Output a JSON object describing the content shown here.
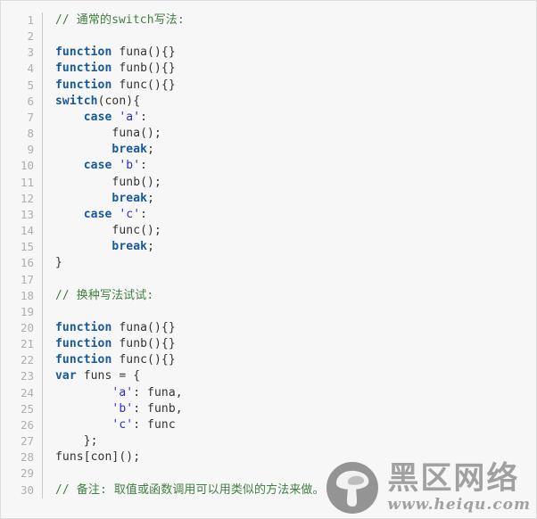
{
  "editor": {
    "title": "javascript-switch-alternative-snippet",
    "language": "javascript",
    "first_line_number": 1,
    "total_lines": 30,
    "colors": {
      "background": "#f7f7f7",
      "border": "#dcdcdc",
      "gutter_text": "#aeaeae",
      "gutter_divider": "#c9c9c9",
      "plain_text": "#333333",
      "keyword": "#15599b",
      "string": "#2b2bc8",
      "comment": "#3f7f3f"
    },
    "lines": [
      {
        "number": "1",
        "tokens": [
          {
            "t": "// 通常的switch写法:",
            "c": "comment"
          }
        ]
      },
      {
        "number": "2",
        "tokens": []
      },
      {
        "number": "3",
        "tokens": [
          {
            "t": "function",
            "c": "kw"
          },
          {
            "t": " funa(){}",
            "c": "plain"
          }
        ]
      },
      {
        "number": "4",
        "tokens": [
          {
            "t": "function",
            "c": "kw"
          },
          {
            "t": " funb(){}",
            "c": "plain"
          }
        ]
      },
      {
        "number": "5",
        "tokens": [
          {
            "t": "function",
            "c": "kw"
          },
          {
            "t": " func(){}",
            "c": "plain"
          }
        ]
      },
      {
        "number": "6",
        "tokens": [
          {
            "t": "switch",
            "c": "kw"
          },
          {
            "t": "(con){",
            "c": "plain"
          }
        ]
      },
      {
        "number": "7",
        "tokens": [
          {
            "t": "    ",
            "c": "plain"
          },
          {
            "t": "case",
            "c": "kw"
          },
          {
            "t": " ",
            "c": "plain"
          },
          {
            "t": "'a'",
            "c": "str"
          },
          {
            "t": ":",
            "c": "plain"
          }
        ]
      },
      {
        "number": "8",
        "tokens": [
          {
            "t": "        funa();",
            "c": "plain"
          }
        ]
      },
      {
        "number": "9",
        "tokens": [
          {
            "t": "        ",
            "c": "plain"
          },
          {
            "t": "break",
            "c": "kw"
          },
          {
            "t": ";",
            "c": "plain"
          }
        ]
      },
      {
        "number": "10",
        "tokens": [
          {
            "t": "    ",
            "c": "plain"
          },
          {
            "t": "case",
            "c": "kw"
          },
          {
            "t": " ",
            "c": "plain"
          },
          {
            "t": "'b'",
            "c": "str"
          },
          {
            "t": ":",
            "c": "plain"
          }
        ]
      },
      {
        "number": "11",
        "tokens": [
          {
            "t": "        funb();",
            "c": "plain"
          }
        ]
      },
      {
        "number": "12",
        "tokens": [
          {
            "t": "        ",
            "c": "plain"
          },
          {
            "t": "break",
            "c": "kw"
          },
          {
            "t": ";",
            "c": "plain"
          }
        ]
      },
      {
        "number": "13",
        "tokens": [
          {
            "t": "    ",
            "c": "plain"
          },
          {
            "t": "case",
            "c": "kw"
          },
          {
            "t": " ",
            "c": "plain"
          },
          {
            "t": "'c'",
            "c": "str"
          },
          {
            "t": ":",
            "c": "plain"
          }
        ]
      },
      {
        "number": "14",
        "tokens": [
          {
            "t": "        func();",
            "c": "plain"
          }
        ]
      },
      {
        "number": "15",
        "tokens": [
          {
            "t": "        ",
            "c": "plain"
          },
          {
            "t": "break",
            "c": "kw"
          },
          {
            "t": ";",
            "c": "plain"
          }
        ]
      },
      {
        "number": "16",
        "tokens": [
          {
            "t": "}",
            "c": "plain"
          }
        ]
      },
      {
        "number": "17",
        "tokens": []
      },
      {
        "number": "18",
        "tokens": [
          {
            "t": "// 换种写法试试:",
            "c": "comment"
          }
        ]
      },
      {
        "number": "19",
        "tokens": []
      },
      {
        "number": "20",
        "tokens": [
          {
            "t": "function",
            "c": "kw"
          },
          {
            "t": " funa(){}",
            "c": "plain"
          }
        ]
      },
      {
        "number": "21",
        "tokens": [
          {
            "t": "function",
            "c": "kw"
          },
          {
            "t": " funb(){}",
            "c": "plain"
          }
        ]
      },
      {
        "number": "22",
        "tokens": [
          {
            "t": "function",
            "c": "kw"
          },
          {
            "t": " func(){}",
            "c": "plain"
          }
        ]
      },
      {
        "number": "23",
        "tokens": [
          {
            "t": "var",
            "c": "kw"
          },
          {
            "t": " funs = {",
            "c": "plain"
          }
        ]
      },
      {
        "number": "24",
        "tokens": [
          {
            "t": "        ",
            "c": "plain"
          },
          {
            "t": "'a'",
            "c": "str"
          },
          {
            "t": ": funa,",
            "c": "plain"
          }
        ]
      },
      {
        "number": "25",
        "tokens": [
          {
            "t": "        ",
            "c": "plain"
          },
          {
            "t": "'b'",
            "c": "str"
          },
          {
            "t": ": funb,",
            "c": "plain"
          }
        ]
      },
      {
        "number": "26",
        "tokens": [
          {
            "t": "        ",
            "c": "plain"
          },
          {
            "t": "'c'",
            "c": "str"
          },
          {
            "t": ": func",
            "c": "plain"
          }
        ]
      },
      {
        "number": "27",
        "tokens": [
          {
            "t": "    };",
            "c": "plain"
          }
        ]
      },
      {
        "number": "28",
        "tokens": [
          {
            "t": "funs[con]();",
            "c": "plain"
          }
        ]
      },
      {
        "number": "29",
        "tokens": []
      },
      {
        "number": "30",
        "tokens": [
          {
            "t": "// 备注: 取值或函数调用可以用类似的方法来做。",
            "c": "comment"
          }
        ]
      }
    ]
  },
  "watermark": {
    "icon": "mushroom-icon",
    "title": "黑区网络",
    "url": "www.heiqu.com",
    "color": "#9a9a9a"
  }
}
